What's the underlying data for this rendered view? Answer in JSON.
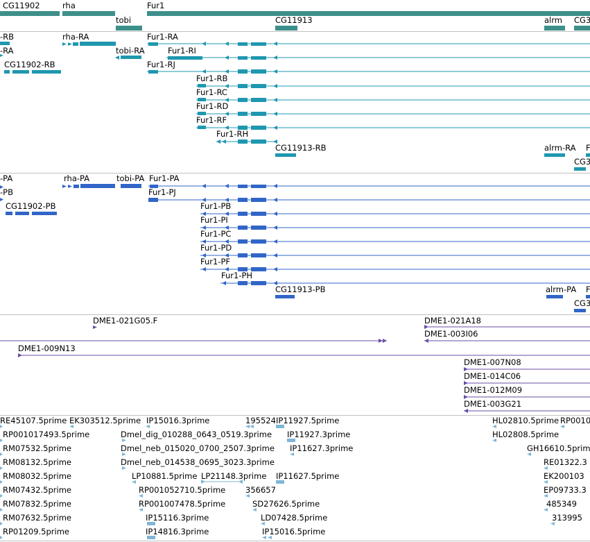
{
  "colors": {
    "gene": "#3d8f8a",
    "transcript": "#1f97b0",
    "protein": "#3166c8",
    "clone": "#6a4ca8",
    "est": "#7fb6d6",
    "separator": "#c0c0c0"
  },
  "genes": [
    {
      "label": "CG11902"
    },
    {
      "label": "rha"
    },
    {
      "label": "tobi"
    },
    {
      "label": "Fur1"
    },
    {
      "label": "CG11913"
    },
    {
      "label": "alrm"
    },
    {
      "label": "CG3"
    }
  ],
  "transcripts": [
    {
      "label": "-RB"
    },
    {
      "label": "-RA"
    },
    {
      "label": "CG11902-RB"
    },
    {
      "label": "rha-RA"
    },
    {
      "label": "tobi-RA"
    },
    {
      "label": "Fur1-RA"
    },
    {
      "label": "Fur1-RI"
    },
    {
      "label": "Fur1-RJ"
    },
    {
      "label": "Fur1-RB"
    },
    {
      "label": "Fur1-RC"
    },
    {
      "label": "Fur1-RD"
    },
    {
      "label": "Fur1-RF"
    },
    {
      "label": "Fur1-RH"
    },
    {
      "label": "CG11913-RB"
    },
    {
      "label": "alrm-RA"
    },
    {
      "label": "F"
    },
    {
      "label": "CG3"
    }
  ],
  "proteins": [
    {
      "label": "-PA"
    },
    {
      "label": "-PB"
    },
    {
      "label": "CG11902-PB"
    },
    {
      "label": "rha-PA"
    },
    {
      "label": "tobi-PA"
    },
    {
      "label": "Fur1-PA"
    },
    {
      "label": "Fur1-PJ"
    },
    {
      "label": "Fur1-PB"
    },
    {
      "label": "Fur1-PI"
    },
    {
      "label": "Fur1-PC"
    },
    {
      "label": "Fur1-PD"
    },
    {
      "label": "Fur1-PF"
    },
    {
      "label": "Fur1-PH"
    },
    {
      "label": "CG11913-PB"
    },
    {
      "label": "alrm-PA"
    },
    {
      "label": "F"
    },
    {
      "label": "CG3"
    }
  ],
  "clones": [
    {
      "label": "DME1-021G05.F"
    },
    {
      "label": "DME1-009N13"
    },
    {
      "label": "DME1-021A18"
    },
    {
      "label": "DME1-003I06"
    },
    {
      "label": "DME1-007N08"
    },
    {
      "label": "DME1-014C06"
    },
    {
      "label": "DME1-012M09"
    },
    {
      "label": "DME1-003G21"
    }
  ],
  "ests": [
    {
      "label": "RE45107.5prime"
    },
    {
      "label": "EK303512.5prime"
    },
    {
      "label": "IP15016.3prime"
    },
    {
      "label": "195524"
    },
    {
      "label": "IP11927.5prime"
    },
    {
      "label": "HL02810.5prime"
    },
    {
      "label": "RP0010"
    },
    {
      "label": "RP001017493.5prime"
    },
    {
      "label": "Dmel_dig_010288_0643_0519.3prime"
    },
    {
      "label": "IP11927.3prime"
    },
    {
      "label": "HL02808.5prime"
    },
    {
      "label": "RM07532.5prime"
    },
    {
      "label": "Dmel_neb_015020_0700_2507.3prime"
    },
    {
      "label": "IP11627.3prime"
    },
    {
      "label": "GH16610.5prim"
    },
    {
      "label": "RM08132.5prime"
    },
    {
      "label": "Dmel_neb_014538_0695_3023.3prime"
    },
    {
      "label": "RE01322.3"
    },
    {
      "label": "RM08032.5prime"
    },
    {
      "label": "LP10881.5prime"
    },
    {
      "label": "LP21148.3prime"
    },
    {
      "label": "IP11627.5prime"
    },
    {
      "label": "EK200103"
    },
    {
      "label": "RM07432.5prime"
    },
    {
      "label": "RP001052710.5prime"
    },
    {
      "label": "356657"
    },
    {
      "label": "EP09733.3"
    },
    {
      "label": "RM07832.5prime"
    },
    {
      "label": "RP001007478.5prime"
    },
    {
      "label": "SD27626.5prime"
    },
    {
      "label": "485349"
    },
    {
      "label": "RM07632.5prime"
    },
    {
      "label": "IP15116.3prime"
    },
    {
      "label": "LD07428.5prime"
    },
    {
      "label": "313995"
    },
    {
      "label": "RP01209.5prime"
    },
    {
      "label": "IP14816.3prime"
    },
    {
      "label": "IP15016.5prime"
    }
  ]
}
